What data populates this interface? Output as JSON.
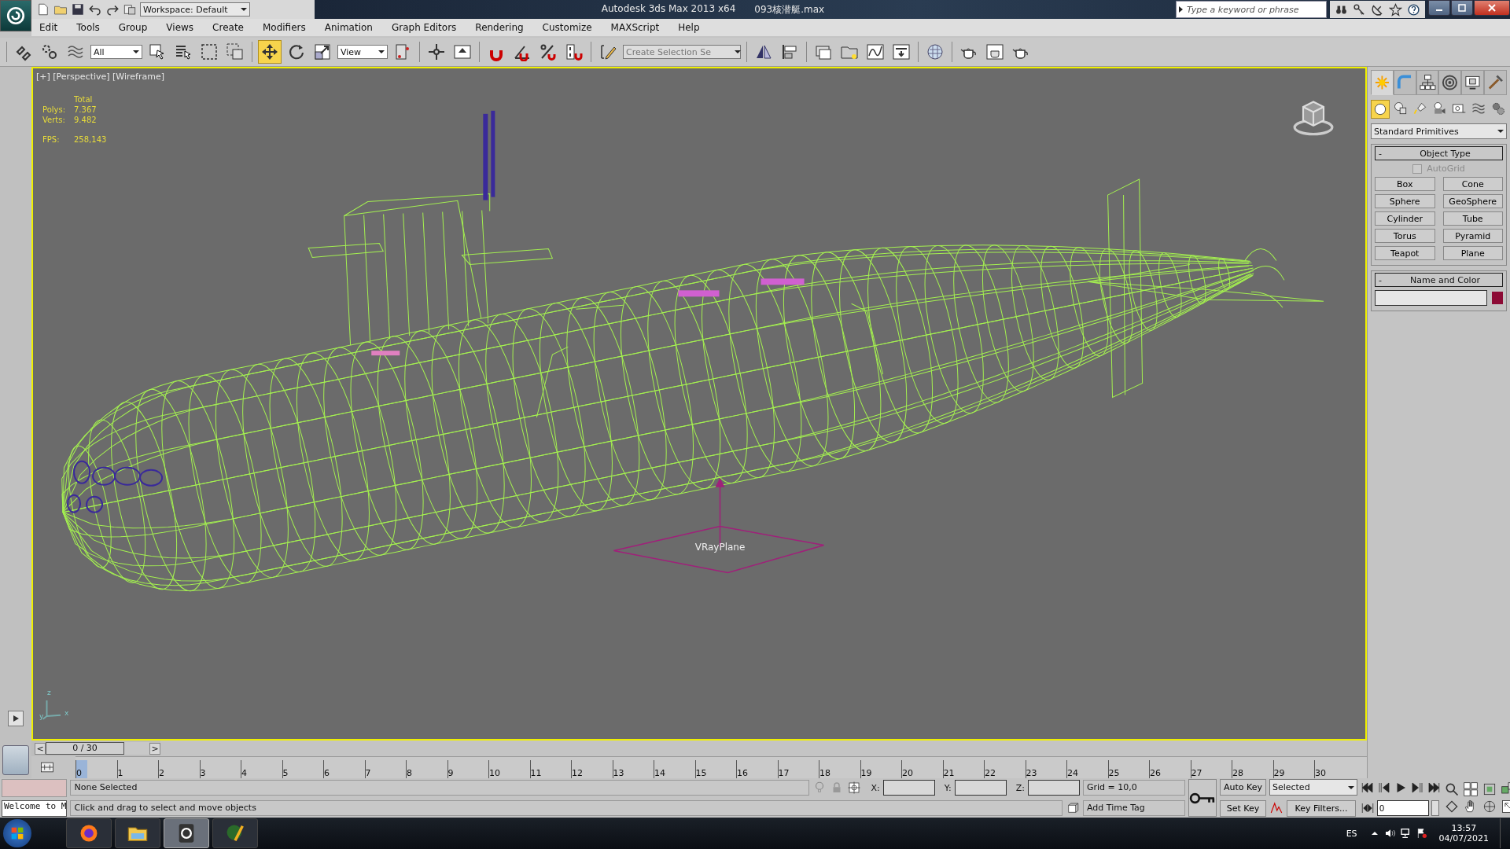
{
  "title_bar": {
    "workspace": "Workspace: Default",
    "title": "Autodesk 3ds Max  2013 x64",
    "file": "093核潜艇.max",
    "search_placeholder": "Type a keyword or phrase"
  },
  "menu": [
    "Edit",
    "Tools",
    "Group",
    "Views",
    "Create",
    "Modifiers",
    "Animation",
    "Graph Editors",
    "Rendering",
    "Customize",
    "MAXScript",
    "Help"
  ],
  "main_toolbar": {
    "selection_filter": "All",
    "reference_coordinates": "View",
    "named_selection_placeholder": "Create Selection Se",
    "transform_tools": [
      {
        "selected": true
      },
      {
        "selected": false
      },
      {
        "selected": false
      }
    ]
  },
  "viewport": {
    "labels": "[+] [Perspective] [Wireframe]",
    "stats_header": "Total",
    "stats": [
      {
        "label": "Polys:",
        "value": "7.367"
      },
      {
        "label": "Verts:",
        "value": "9.482"
      }
    ],
    "fps": {
      "label": "FPS:",
      "value": "258,143"
    },
    "object_label": "VRayPlane",
    "axis_labels": [
      "z",
      "y",
      "x"
    ]
  },
  "command_panel": {
    "tabs": [
      {
        "selected": true
      },
      {
        "selected": false
      },
      {
        "selected": false
      },
      {
        "selected": false
      },
      {
        "selected": false
      },
      {
        "selected": false
      }
    ],
    "categories": [
      {
        "selected": true
      },
      {
        "selected": false
      },
      {
        "selected": false
      },
      {
        "selected": false
      },
      {
        "selected": false
      },
      {
        "selected": false
      },
      {
        "selected": false
      }
    ],
    "dropdown": "Standard Primitives",
    "object_type": {
      "collapse": "-",
      "title": "Object Type",
      "autogrid": {
        "label": "AutoGrid",
        "checked": false,
        "disabled": true
      },
      "buttons": [
        "Box",
        "Cone",
        "Sphere",
        "GeoSphere",
        "Cylinder",
        "Tube",
        "Torus",
        "Pyramid",
        "Teapot",
        "Plane"
      ]
    },
    "name_and_color": {
      "collapse": "-",
      "title": "Name and Color",
      "color": "#8c0a35"
    }
  },
  "time_slider": {
    "previous": "<",
    "position": "0 / 30",
    "next": ">",
    "level": 0
  },
  "track_bar": {
    "ticks": [
      "0",
      "1",
      "2",
      "3",
      "4",
      "5",
      "6",
      "7",
      "8",
      "9",
      "10",
      "11",
      "12",
      "13",
      "14",
      "15",
      "16",
      "17",
      "18",
      "19",
      "20",
      "21",
      "22",
      "23",
      "24",
      "25",
      "26",
      "27",
      "28",
      "29",
      "30"
    ]
  },
  "status": {
    "listener": "Welcome to M",
    "selection": "None Selected",
    "prompt": "Click and drag to select and move objects",
    "x_label": "X:",
    "y_label": "Y:",
    "z_label": "Z:",
    "grid": "Grid = 10,0",
    "time_tag": "Add Time Tag"
  },
  "animation": {
    "auto_key": "Auto Key",
    "set_key": "Set Key",
    "key_mode": "Selected",
    "key_filters": "Key Filters...",
    "current_frame": "0"
  },
  "taskbar": {
    "apps": [
      {
        "selected": false
      },
      {
        "selected": false
      },
      {
        "selected": true
      },
      {
        "selected": false
      }
    ],
    "language": "ES",
    "time": "13:57",
    "date": "04/07/2021"
  }
}
